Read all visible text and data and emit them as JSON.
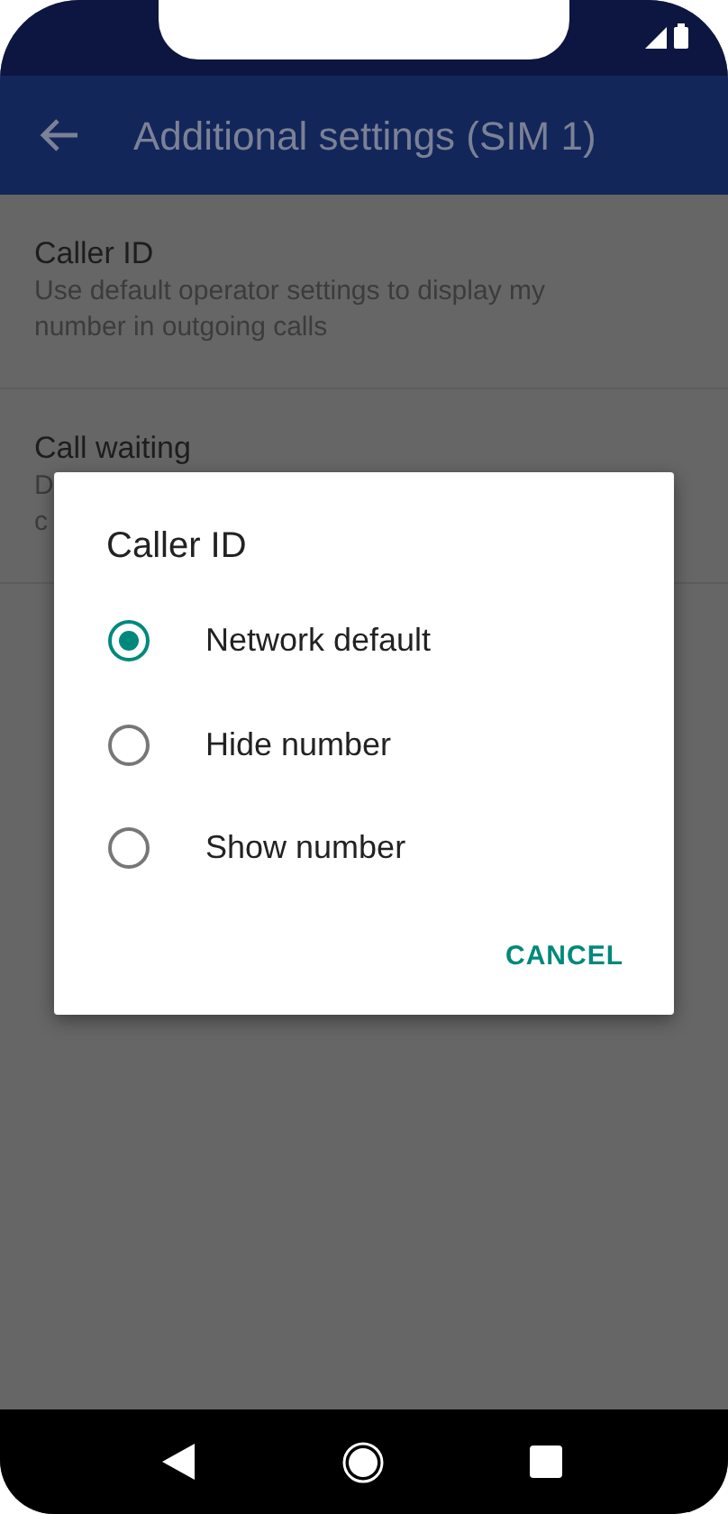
{
  "app_bar": {
    "title": "Additional settings (SIM 1)"
  },
  "settings": [
    {
      "title": "Caller ID",
      "description": [
        "Use default operator settings to display my number in outgoing calls"
      ]
    },
    {
      "title": "Call waiting",
      "description": [
        "D",
        "c"
      ]
    }
  ],
  "dialog": {
    "title": "Caller ID",
    "options": [
      {
        "label": "Network default",
        "selected": true
      },
      {
        "label": "Hide number",
        "selected": false
      },
      {
        "label": "Show number",
        "selected": false
      }
    ],
    "buttons": [
      "CANCEL"
    ]
  }
}
